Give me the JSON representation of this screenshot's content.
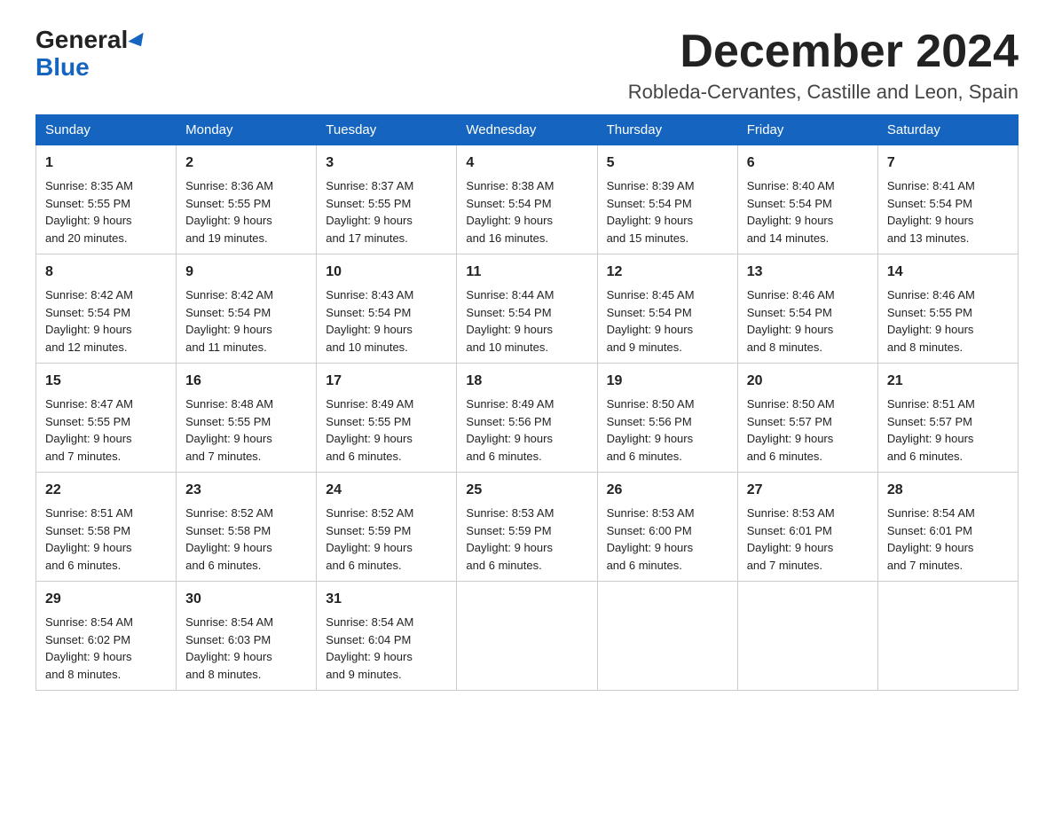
{
  "header": {
    "logo_general": "General",
    "logo_blue": "Blue",
    "title": "December 2024",
    "subtitle": "Robleda-Cervantes, Castille and Leon, Spain"
  },
  "weekdays": [
    "Sunday",
    "Monday",
    "Tuesday",
    "Wednesday",
    "Thursday",
    "Friday",
    "Saturday"
  ],
  "weeks": [
    [
      {
        "day": "1",
        "sunrise": "8:35 AM",
        "sunset": "5:55 PM",
        "daylight": "9 hours and 20 minutes."
      },
      {
        "day": "2",
        "sunrise": "8:36 AM",
        "sunset": "5:55 PM",
        "daylight": "9 hours and 19 minutes."
      },
      {
        "day": "3",
        "sunrise": "8:37 AM",
        "sunset": "5:55 PM",
        "daylight": "9 hours and 17 minutes."
      },
      {
        "day": "4",
        "sunrise": "8:38 AM",
        "sunset": "5:54 PM",
        "daylight": "9 hours and 16 minutes."
      },
      {
        "day": "5",
        "sunrise": "8:39 AM",
        "sunset": "5:54 PM",
        "daylight": "9 hours and 15 minutes."
      },
      {
        "day": "6",
        "sunrise": "8:40 AM",
        "sunset": "5:54 PM",
        "daylight": "9 hours and 14 minutes."
      },
      {
        "day": "7",
        "sunrise": "8:41 AM",
        "sunset": "5:54 PM",
        "daylight": "9 hours and 13 minutes."
      }
    ],
    [
      {
        "day": "8",
        "sunrise": "8:42 AM",
        "sunset": "5:54 PM",
        "daylight": "9 hours and 12 minutes."
      },
      {
        "day": "9",
        "sunrise": "8:42 AM",
        "sunset": "5:54 PM",
        "daylight": "9 hours and 11 minutes."
      },
      {
        "day": "10",
        "sunrise": "8:43 AM",
        "sunset": "5:54 PM",
        "daylight": "9 hours and 10 minutes."
      },
      {
        "day": "11",
        "sunrise": "8:44 AM",
        "sunset": "5:54 PM",
        "daylight": "9 hours and 10 minutes."
      },
      {
        "day": "12",
        "sunrise": "8:45 AM",
        "sunset": "5:54 PM",
        "daylight": "9 hours and 9 minutes."
      },
      {
        "day": "13",
        "sunrise": "8:46 AM",
        "sunset": "5:54 PM",
        "daylight": "9 hours and 8 minutes."
      },
      {
        "day": "14",
        "sunrise": "8:46 AM",
        "sunset": "5:55 PM",
        "daylight": "9 hours and 8 minutes."
      }
    ],
    [
      {
        "day": "15",
        "sunrise": "8:47 AM",
        "sunset": "5:55 PM",
        "daylight": "9 hours and 7 minutes."
      },
      {
        "day": "16",
        "sunrise": "8:48 AM",
        "sunset": "5:55 PM",
        "daylight": "9 hours and 7 minutes."
      },
      {
        "day": "17",
        "sunrise": "8:49 AM",
        "sunset": "5:55 PM",
        "daylight": "9 hours and 6 minutes."
      },
      {
        "day": "18",
        "sunrise": "8:49 AM",
        "sunset": "5:56 PM",
        "daylight": "9 hours and 6 minutes."
      },
      {
        "day": "19",
        "sunrise": "8:50 AM",
        "sunset": "5:56 PM",
        "daylight": "9 hours and 6 minutes."
      },
      {
        "day": "20",
        "sunrise": "8:50 AM",
        "sunset": "5:57 PM",
        "daylight": "9 hours and 6 minutes."
      },
      {
        "day": "21",
        "sunrise": "8:51 AM",
        "sunset": "5:57 PM",
        "daylight": "9 hours and 6 minutes."
      }
    ],
    [
      {
        "day": "22",
        "sunrise": "8:51 AM",
        "sunset": "5:58 PM",
        "daylight": "9 hours and 6 minutes."
      },
      {
        "day": "23",
        "sunrise": "8:52 AM",
        "sunset": "5:58 PM",
        "daylight": "9 hours and 6 minutes."
      },
      {
        "day": "24",
        "sunrise": "8:52 AM",
        "sunset": "5:59 PM",
        "daylight": "9 hours and 6 minutes."
      },
      {
        "day": "25",
        "sunrise": "8:53 AM",
        "sunset": "5:59 PM",
        "daylight": "9 hours and 6 minutes."
      },
      {
        "day": "26",
        "sunrise": "8:53 AM",
        "sunset": "6:00 PM",
        "daylight": "9 hours and 6 minutes."
      },
      {
        "day": "27",
        "sunrise": "8:53 AM",
        "sunset": "6:01 PM",
        "daylight": "9 hours and 7 minutes."
      },
      {
        "day": "28",
        "sunrise": "8:54 AM",
        "sunset": "6:01 PM",
        "daylight": "9 hours and 7 minutes."
      }
    ],
    [
      {
        "day": "29",
        "sunrise": "8:54 AM",
        "sunset": "6:02 PM",
        "daylight": "9 hours and 8 minutes."
      },
      {
        "day": "30",
        "sunrise": "8:54 AM",
        "sunset": "6:03 PM",
        "daylight": "9 hours and 8 minutes."
      },
      {
        "day": "31",
        "sunrise": "8:54 AM",
        "sunset": "6:04 PM",
        "daylight": "9 hours and 9 minutes."
      },
      null,
      null,
      null,
      null
    ]
  ],
  "labels": {
    "sunrise": "Sunrise:",
    "sunset": "Sunset:",
    "daylight": "Daylight:"
  }
}
